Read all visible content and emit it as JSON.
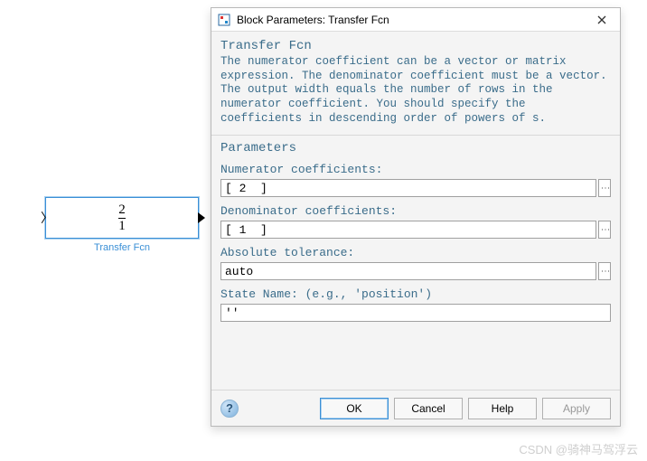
{
  "block": {
    "numerator": "2",
    "denominator": "1",
    "caption": "Transfer Fcn"
  },
  "dialog": {
    "title": "Block Parameters: Transfer Fcn",
    "section": "Transfer Fcn",
    "description": "The numerator coefficient can be a vector or matrix expression. The denominator coefficient must be a vector. The output width equals the number of rows in the numerator coefficient. You should specify the coefficients in descending order of powers of s.",
    "params_heading": "Parameters",
    "fields": {
      "numerator": {
        "label": "Numerator coefficients:",
        "value": "[ 2  ]"
      },
      "denominator": {
        "label": "Denominator coefficients:",
        "value": "[ 1  ]"
      },
      "abstol": {
        "label": "Absolute tolerance:",
        "value": "auto"
      },
      "statename": {
        "label": "State Name: (e.g., 'position')",
        "value": "''"
      }
    },
    "buttons": {
      "ok": "OK",
      "cancel": "Cancel",
      "help": "Help",
      "apply": "Apply"
    }
  },
  "watermark": "CSDN @骑神马驾浮云"
}
